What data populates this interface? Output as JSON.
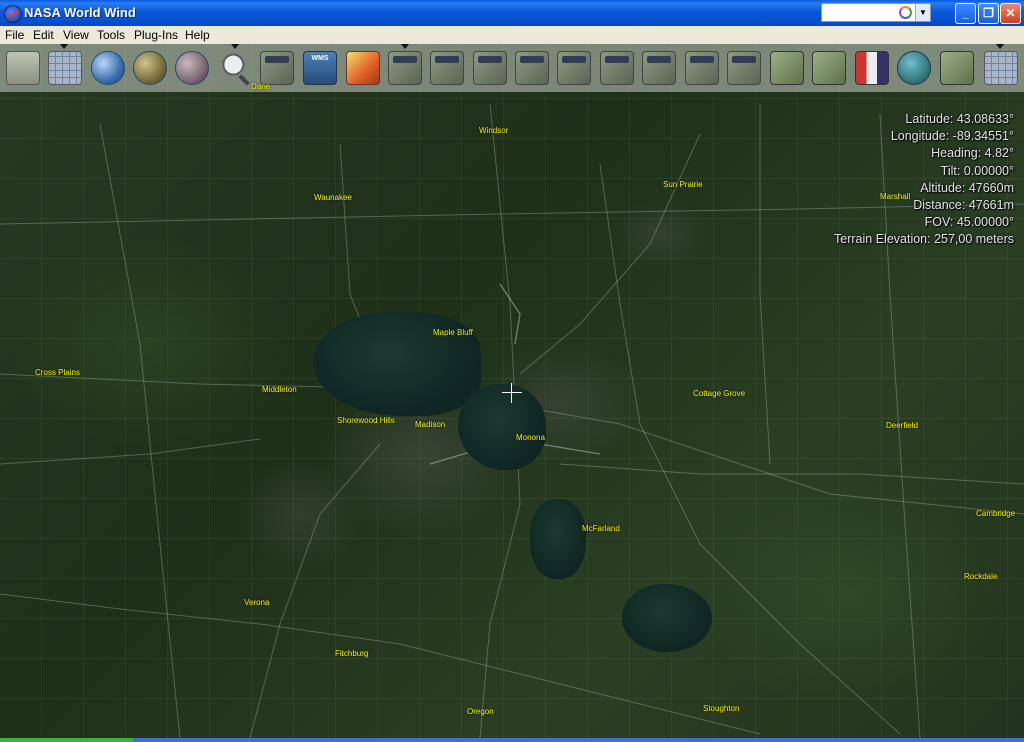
{
  "window": {
    "title": "NASA World Wind",
    "controls": {
      "minimize_icon": "minimize-icon",
      "maximize_icon": "restore-icon",
      "close_icon": "close-icon"
    }
  },
  "menu": [
    "File",
    "Edit",
    "View",
    "Tools",
    "Plug-Ins",
    "Help"
  ],
  "toolbar": {
    "buttons": [
      "layer-manager-icon",
      "lat-long-grid-icon",
      "blue-marble-icon",
      "globe-icon",
      "globe-icon",
      "search-icon",
      "animated-earth-icon",
      "wms-icon",
      "weather-icon",
      "landsat-icon",
      "landsat-icon",
      "landsat-icon",
      "landsat-icon",
      "landsat-icon",
      "landsat-icon",
      "landsat-icon",
      "landsat-icon",
      "landsat-icon",
      "usgs-icon",
      "usgs-icon",
      "flags-icon",
      "landmarks-icon",
      "places-icon",
      "compass-icon"
    ]
  },
  "map_labels": [
    {
      "id": "dane",
      "text": "Dane"
    },
    {
      "id": "windsor",
      "text": "Windsor"
    },
    {
      "id": "sun-prairie",
      "text": "Sun Prairie"
    },
    {
      "id": "waunakee",
      "text": "Waunakee"
    },
    {
      "id": "marshall",
      "text": "Marshall"
    },
    {
      "id": "maple-bluff",
      "text": "Maple Bluff"
    },
    {
      "id": "cross-plains",
      "text": "Cross Plains"
    },
    {
      "id": "middleton",
      "text": "Middleton"
    },
    {
      "id": "cottage-grove",
      "text": "Cottage Grove"
    },
    {
      "id": "shorewood-hills",
      "text": "Shorewood Hills"
    },
    {
      "id": "madison",
      "text": "Madison"
    },
    {
      "id": "monona",
      "text": "Monona"
    },
    {
      "id": "deerfield",
      "text": "Deerfield"
    },
    {
      "id": "mcfarland",
      "text": "McFarland"
    },
    {
      "id": "cambridge",
      "text": "Cambridge"
    },
    {
      "id": "rockdale",
      "text": "Rockdale"
    },
    {
      "id": "verona",
      "text": "Verona"
    },
    {
      "id": "fitchburg",
      "text": "Fitchburg"
    },
    {
      "id": "oregon",
      "text": "Oregon"
    },
    {
      "id": "stoughton",
      "text": "Stoughton"
    }
  ],
  "info": {
    "latitude": "Latitude: 43.08633°",
    "longitude": "Longitude: -89.34551°",
    "heading": "Heading: 4.82°",
    "tilt": "Tilt: 0.00000°",
    "altitude": "Altitude: 47660m",
    "distance": "Distance: 47661m",
    "fov": "FOV: 45.00000°",
    "terrain": "Terrain Elevation: 257,00 meters"
  },
  "colors": {
    "label": "#f6f400",
    "titlebar": "#0650d2",
    "menubar": "#ece9d8"
  }
}
